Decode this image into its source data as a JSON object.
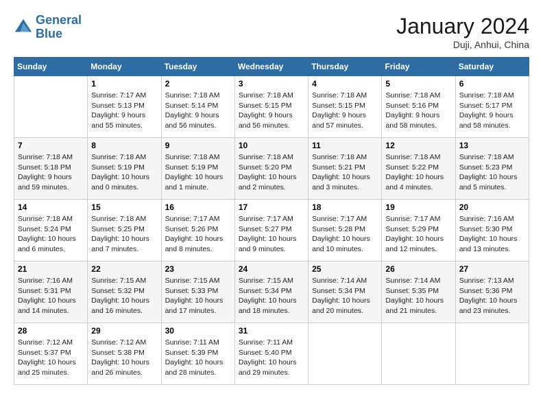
{
  "header": {
    "logo_line1": "General",
    "logo_line2": "Blue",
    "month_title": "January 2024",
    "subtitle": "Duji, Anhui, China"
  },
  "days_of_week": [
    "Sunday",
    "Monday",
    "Tuesday",
    "Wednesday",
    "Thursday",
    "Friday",
    "Saturday"
  ],
  "weeks": [
    [
      {
        "day": "",
        "sunrise": "",
        "sunset": "",
        "daylight": ""
      },
      {
        "day": "1",
        "sunrise": "Sunrise: 7:17 AM",
        "sunset": "Sunset: 5:13 PM",
        "daylight": "Daylight: 9 hours and 55 minutes."
      },
      {
        "day": "2",
        "sunrise": "Sunrise: 7:18 AM",
        "sunset": "Sunset: 5:14 PM",
        "daylight": "Daylight: 9 hours and 56 minutes."
      },
      {
        "day": "3",
        "sunrise": "Sunrise: 7:18 AM",
        "sunset": "Sunset: 5:15 PM",
        "daylight": "Daylight: 9 hours and 56 minutes."
      },
      {
        "day": "4",
        "sunrise": "Sunrise: 7:18 AM",
        "sunset": "Sunset: 5:15 PM",
        "daylight": "Daylight: 9 hours and 57 minutes."
      },
      {
        "day": "5",
        "sunrise": "Sunrise: 7:18 AM",
        "sunset": "Sunset: 5:16 PM",
        "daylight": "Daylight: 9 hours and 58 minutes."
      },
      {
        "day": "6",
        "sunrise": "Sunrise: 7:18 AM",
        "sunset": "Sunset: 5:17 PM",
        "daylight": "Daylight: 9 hours and 58 minutes."
      }
    ],
    [
      {
        "day": "7",
        "sunrise": "Sunrise: 7:18 AM",
        "sunset": "Sunset: 5:18 PM",
        "daylight": "Daylight: 9 hours and 59 minutes."
      },
      {
        "day": "8",
        "sunrise": "Sunrise: 7:18 AM",
        "sunset": "Sunset: 5:19 PM",
        "daylight": "Daylight: 10 hours and 0 minutes."
      },
      {
        "day": "9",
        "sunrise": "Sunrise: 7:18 AM",
        "sunset": "Sunset: 5:19 PM",
        "daylight": "Daylight: 10 hours and 1 minute."
      },
      {
        "day": "10",
        "sunrise": "Sunrise: 7:18 AM",
        "sunset": "Sunset: 5:20 PM",
        "daylight": "Daylight: 10 hours and 2 minutes."
      },
      {
        "day": "11",
        "sunrise": "Sunrise: 7:18 AM",
        "sunset": "Sunset: 5:21 PM",
        "daylight": "Daylight: 10 hours and 3 minutes."
      },
      {
        "day": "12",
        "sunrise": "Sunrise: 7:18 AM",
        "sunset": "Sunset: 5:22 PM",
        "daylight": "Daylight: 10 hours and 4 minutes."
      },
      {
        "day": "13",
        "sunrise": "Sunrise: 7:18 AM",
        "sunset": "Sunset: 5:23 PM",
        "daylight": "Daylight: 10 hours and 5 minutes."
      }
    ],
    [
      {
        "day": "14",
        "sunrise": "Sunrise: 7:18 AM",
        "sunset": "Sunset: 5:24 PM",
        "daylight": "Daylight: 10 hours and 6 minutes."
      },
      {
        "day": "15",
        "sunrise": "Sunrise: 7:18 AM",
        "sunset": "Sunset: 5:25 PM",
        "daylight": "Daylight: 10 hours and 7 minutes."
      },
      {
        "day": "16",
        "sunrise": "Sunrise: 7:17 AM",
        "sunset": "Sunset: 5:26 PM",
        "daylight": "Daylight: 10 hours and 8 minutes."
      },
      {
        "day": "17",
        "sunrise": "Sunrise: 7:17 AM",
        "sunset": "Sunset: 5:27 PM",
        "daylight": "Daylight: 10 hours and 9 minutes."
      },
      {
        "day": "18",
        "sunrise": "Sunrise: 7:17 AM",
        "sunset": "Sunset: 5:28 PM",
        "daylight": "Daylight: 10 hours and 10 minutes."
      },
      {
        "day": "19",
        "sunrise": "Sunrise: 7:17 AM",
        "sunset": "Sunset: 5:29 PM",
        "daylight": "Daylight: 10 hours and 12 minutes."
      },
      {
        "day": "20",
        "sunrise": "Sunrise: 7:16 AM",
        "sunset": "Sunset: 5:30 PM",
        "daylight": "Daylight: 10 hours and 13 minutes."
      }
    ],
    [
      {
        "day": "21",
        "sunrise": "Sunrise: 7:16 AM",
        "sunset": "Sunset: 5:31 PM",
        "daylight": "Daylight: 10 hours and 14 minutes."
      },
      {
        "day": "22",
        "sunrise": "Sunrise: 7:15 AM",
        "sunset": "Sunset: 5:32 PM",
        "daylight": "Daylight: 10 hours and 16 minutes."
      },
      {
        "day": "23",
        "sunrise": "Sunrise: 7:15 AM",
        "sunset": "Sunset: 5:33 PM",
        "daylight": "Daylight: 10 hours and 17 minutes."
      },
      {
        "day": "24",
        "sunrise": "Sunrise: 7:15 AM",
        "sunset": "Sunset: 5:34 PM",
        "daylight": "Daylight: 10 hours and 18 minutes."
      },
      {
        "day": "25",
        "sunrise": "Sunrise: 7:14 AM",
        "sunset": "Sunset: 5:34 PM",
        "daylight": "Daylight: 10 hours and 20 minutes."
      },
      {
        "day": "26",
        "sunrise": "Sunrise: 7:14 AM",
        "sunset": "Sunset: 5:35 PM",
        "daylight": "Daylight: 10 hours and 21 minutes."
      },
      {
        "day": "27",
        "sunrise": "Sunrise: 7:13 AM",
        "sunset": "Sunset: 5:36 PM",
        "daylight": "Daylight: 10 hours and 23 minutes."
      }
    ],
    [
      {
        "day": "28",
        "sunrise": "Sunrise: 7:12 AM",
        "sunset": "Sunset: 5:37 PM",
        "daylight": "Daylight: 10 hours and 25 minutes."
      },
      {
        "day": "29",
        "sunrise": "Sunrise: 7:12 AM",
        "sunset": "Sunset: 5:38 PM",
        "daylight": "Daylight: 10 hours and 26 minutes."
      },
      {
        "day": "30",
        "sunrise": "Sunrise: 7:11 AM",
        "sunset": "Sunset: 5:39 PM",
        "daylight": "Daylight: 10 hours and 28 minutes."
      },
      {
        "day": "31",
        "sunrise": "Sunrise: 7:11 AM",
        "sunset": "Sunset: 5:40 PM",
        "daylight": "Daylight: 10 hours and 29 minutes."
      },
      {
        "day": "",
        "sunrise": "",
        "sunset": "",
        "daylight": ""
      },
      {
        "day": "",
        "sunrise": "",
        "sunset": "",
        "daylight": ""
      },
      {
        "day": "",
        "sunrise": "",
        "sunset": "",
        "daylight": ""
      }
    ]
  ]
}
